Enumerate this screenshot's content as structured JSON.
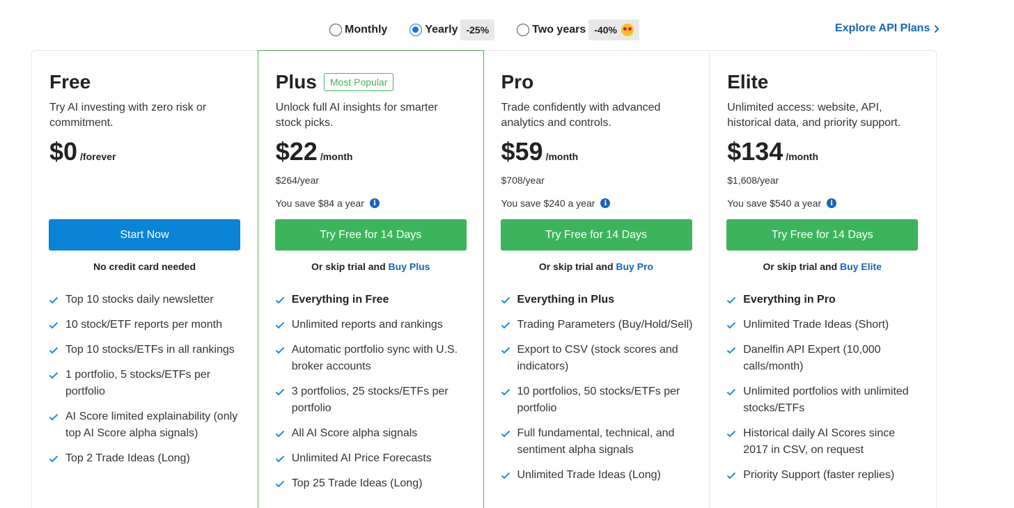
{
  "billing": {
    "options": [
      {
        "label": "Monthly",
        "discount": "",
        "selected": false
      },
      {
        "label": "Yearly",
        "discount": "-25%",
        "selected": true
      },
      {
        "label": "Two years",
        "discount": "-40%",
        "selected": false
      }
    ]
  },
  "api_link": "Explore API Plans",
  "colors": {
    "primary_blue": "#0a84d6",
    "green": "#3cb45c",
    "link": "#1565c0"
  },
  "plans": [
    {
      "name": "Free",
      "badge": "",
      "description": "Try AI investing with zero risk or commitment.",
      "price": "$0",
      "per": "/forever",
      "yearly": "",
      "save": "",
      "cta": "Start Now",
      "sub_text": "No credit card needed",
      "sub_link": "",
      "features": [
        {
          "text": "Top 10 stocks daily newsletter",
          "bold": false
        },
        {
          "text": "10 stock/ETF reports per month",
          "bold": false
        },
        {
          "text": "Top 10 stocks/ETFs in all rankings",
          "bold": false
        },
        {
          "text": "1 portfolio, 5 stocks/ETFs per portfolio",
          "bold": false
        },
        {
          "text": "AI Score limited explainability (only top AI Score alpha signals)",
          "bold": false
        },
        {
          "text": "Top 2 Trade Ideas (Long)",
          "bold": false
        }
      ]
    },
    {
      "name": "Plus",
      "badge": "Most Popular",
      "description": "Unlock full AI insights for smarter stock picks.",
      "price": "$22",
      "per": "/month",
      "yearly": "$264/year",
      "save": "You save $84 a year",
      "cta": "Try Free for 14 Days",
      "sub_text": "Or skip trial and",
      "sub_link": "Buy Plus",
      "features": [
        {
          "text": "Everything in Free",
          "bold": true
        },
        {
          "text": "Unlimited reports and rankings",
          "bold": false
        },
        {
          "text": "Automatic portfolio sync with U.S. broker accounts",
          "bold": false
        },
        {
          "text": "3 portfolios, 25 stocks/ETFs per portfolio",
          "bold": false
        },
        {
          "text": "All AI Score alpha signals",
          "bold": false
        },
        {
          "text": "Unlimited AI Price Forecasts",
          "bold": false
        },
        {
          "text": "Top 25 Trade Ideas (Long)",
          "bold": false
        }
      ]
    },
    {
      "name": "Pro",
      "badge": "",
      "description": "Trade confidently with advanced analytics and controls.",
      "price": "$59",
      "per": "/month",
      "yearly": "$708/year",
      "save": "You save $240 a year",
      "cta": "Try Free for 14 Days",
      "sub_text": "Or skip trial and",
      "sub_link": "Buy Pro",
      "features": [
        {
          "text": "Everything in Plus",
          "bold": true
        },
        {
          "text": "Trading Parameters (Buy/Hold/Sell)",
          "bold": false
        },
        {
          "text": "Export to CSV (stock scores and indicators)",
          "bold": false
        },
        {
          "text": "10 portfolios, 50 stocks/ETFs per portfolio",
          "bold": false
        },
        {
          "text": "Full fundamental, technical, and sentiment alpha signals",
          "bold": false
        },
        {
          "text": "Unlimited Trade Ideas (Long)",
          "bold": false
        }
      ]
    },
    {
      "name": "Elite",
      "badge": "",
      "description": "Unlimited access: website, API, historical data, and priority support.",
      "price": "$134",
      "per": "/month",
      "yearly": "$1,608/year",
      "save": "You save $540 a year",
      "cta": "Try Free for 14 Days",
      "sub_text": "Or skip trial and",
      "sub_link": "Buy Elite",
      "features": [
        {
          "text": "Everything in Pro",
          "bold": true
        },
        {
          "text": "Unlimited Trade Ideas (Short)",
          "bold": false
        },
        {
          "text": "Danelfin API Expert (10,000 calls/month)",
          "bold": false
        },
        {
          "text": "Unlimited portfolios with unlimited stocks/ETFs",
          "bold": false
        },
        {
          "text": "Historical daily AI Scores since 2017 in CSV, on request",
          "bold": false
        },
        {
          "text": "Priority Support (faster replies)",
          "bold": false
        }
      ]
    }
  ]
}
